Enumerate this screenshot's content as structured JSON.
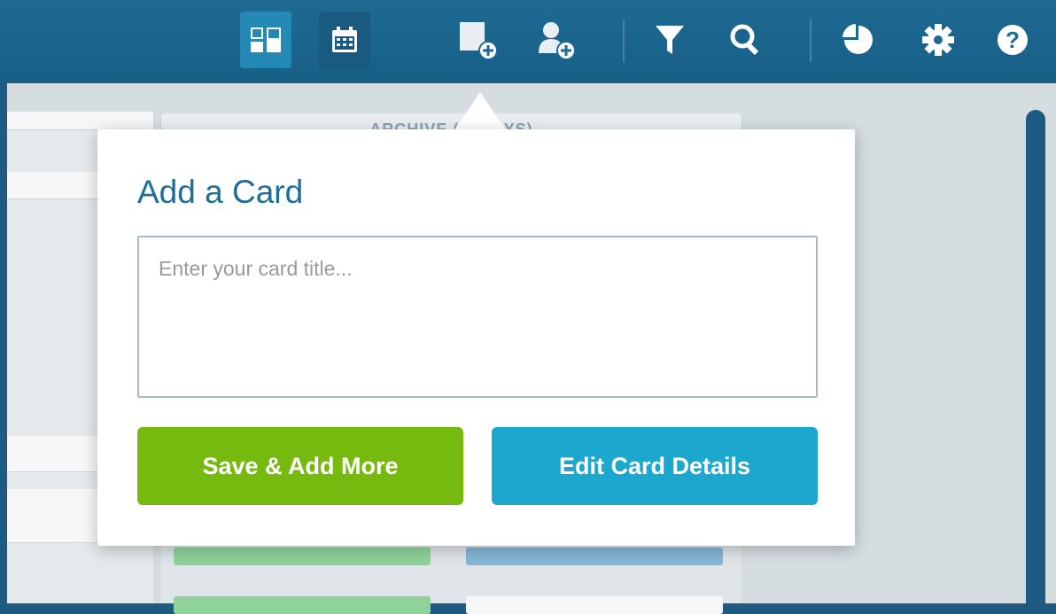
{
  "toolbar": {
    "buttons": [
      {
        "icon": "board-view-icon",
        "active": true
      },
      {
        "icon": "calendar-icon"
      },
      {
        "icon": "add-card-icon"
      },
      {
        "icon": "add-user-icon"
      },
      {
        "icon": "filter-icon"
      },
      {
        "icon": "search-icon"
      },
      {
        "icon": "analytics-icon"
      },
      {
        "icon": "settings-gear-icon"
      },
      {
        "icon": "help-icon"
      }
    ]
  },
  "board": {
    "column_header": "ARCHIVE (... DAYS)"
  },
  "popup": {
    "title": "Add a Card",
    "input_placeholder": "Enter your card title...",
    "input_value": "",
    "save_label": "Save & Add More",
    "edit_label": "Edit Card Details"
  },
  "colors": {
    "toolbar": "#1e6a93",
    "save_button": "#76b90f",
    "edit_button": "#1ca7cf",
    "title": "#1d6e98"
  }
}
